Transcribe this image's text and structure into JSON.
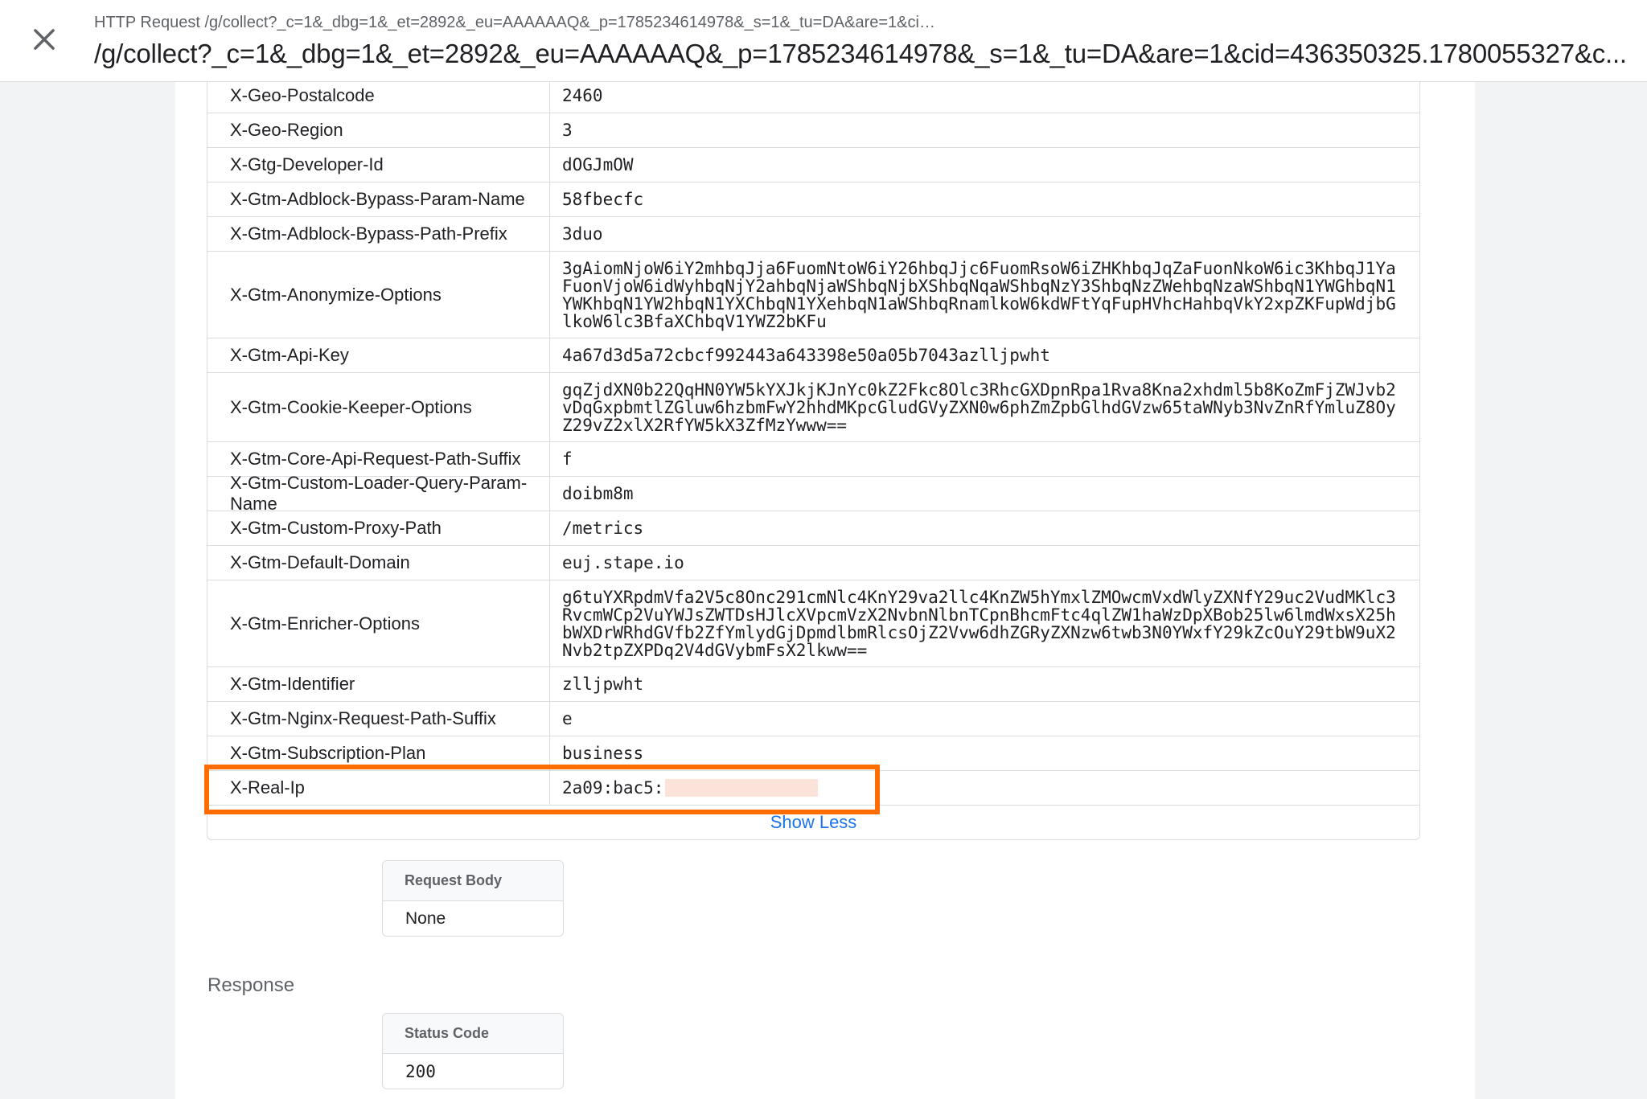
{
  "header": {
    "request_kind": "HTTP Request /g/collect?_c=1&_dbg=1&_et=2892&_eu=AAAAAAQ&_p=1785234614978&_s=1&_tu=DA&are=1&ci…",
    "url": "/g/collect?_c=1&_dbg=1&_et=2892&_eu=AAAAAAQ&_p=1785234614978&_s=1&_tu=DA&are=1&cid=436350325.1780055327&c..."
  },
  "headers": [
    {
      "name": "X-Geo-Postalcode",
      "value": "2460"
    },
    {
      "name": "X-Geo-Region",
      "value": "3"
    },
    {
      "name": "X-Gtg-Developer-Id",
      "value": "dOGJmOW"
    },
    {
      "name": "X-Gtm-Adblock-Bypass-Param-Name",
      "value": "58fbecfc"
    },
    {
      "name": "X-Gtm-Adblock-Bypass-Path-Prefix",
      "value": "3duo"
    },
    {
      "name": "X-Gtm-Anonymize-Options",
      "value": "3gAiomNjoW6iY2mhbqJja6FuomNtoW6iY26hbqJjc6FuomRsoW6iZHKhbqJqZaFuonNkoW6ic3KhbqJ1YaFuonVjoW6idWyhbqNjY2ahbqNjaWShbqNjbXShbqNqaWShbqNzY3ShbqNzZWehbqNzaWShbqN1YWGhbqN1YWKhbqN1YW2hbqN1YXChbqN1YXehbqN1aWShbqRnamlkoW6kdWFtYqFupHVhcHahbqVkY2xpZKFupWdjbGlkoW6lc3BfaXChbqV1YWZ2bKFu"
    },
    {
      "name": "X-Gtm-Api-Key",
      "value": "4a67d3d5a72cbcf992443a643398e50a05b7043azlljpwht"
    },
    {
      "name": "X-Gtm-Cookie-Keeper-Options",
      "value": "gqZjdXN0b22QqHN0YW5kYXJkjKJnYc0kZ2Fkc8Olc3RhcGXDpnRpa1Rva8Kna2xhdml5b8KoZmFjZWJvb2vDqGxpbmtlZGluw6hzbmFwY2hhdMKpcGludGVyZXN0w6phZmZpbGlhdGVzw65taWNyb3NvZnRfYmluZ8OyZ29vZ2xlX2RfYW5kX3ZfMzYwww=="
    },
    {
      "name": "X-Gtm-Core-Api-Request-Path-Suffix",
      "value": "f"
    },
    {
      "name": "X-Gtm-Custom-Loader-Query-Param-Name",
      "value": "doibm8m"
    },
    {
      "name": "X-Gtm-Custom-Proxy-Path",
      "value": "/metrics"
    },
    {
      "name": "X-Gtm-Default-Domain",
      "value": "euj.stape.io"
    },
    {
      "name": "X-Gtm-Enricher-Options",
      "value": "g6tuYXRpdmVfa2V5c8Onc291cmNlc4KnY29va2llc4KnZW5hYmxlZMOwcmVxdWlyZXNfY29uc2VudMKlc3RvcmWCp2VuYWJsZWTDsHJlcXVpcmVzX2NvbnNlbnTCpnBhcmFtc4qlZW1haWzDpXBob25lw6lmdWxsX25hbWXDrWRhdGVfb2ZfYmlydGjDpmdlbmRlcsOjZ2Vvw6dhZGRyZXNzw6twb3N0YWxfY29kZcOuY29tbW9uX2Nvb2tpZXPDq2V4dGVybmFsX2lkww=="
    },
    {
      "name": "X-Gtm-Identifier",
      "value": "zlljpwht"
    },
    {
      "name": "X-Gtm-Nginx-Request-Path-Suffix",
      "value": "e"
    },
    {
      "name": "X-Gtm-Subscription-Plan",
      "value": "business"
    },
    {
      "name": "X-Real-Ip",
      "value": "2a09:bac5:"
    }
  ],
  "show_less_label": "Show Less",
  "request_body": {
    "label": "Request Body",
    "value": "None"
  },
  "response": {
    "title": "Response",
    "status_label": "Status Code",
    "status_value": "200"
  },
  "colors": {
    "highlight": "#ff6d00",
    "link": "#1a73e8",
    "redaction": "#fbe3da"
  },
  "icons": {
    "close": "close-icon"
  }
}
